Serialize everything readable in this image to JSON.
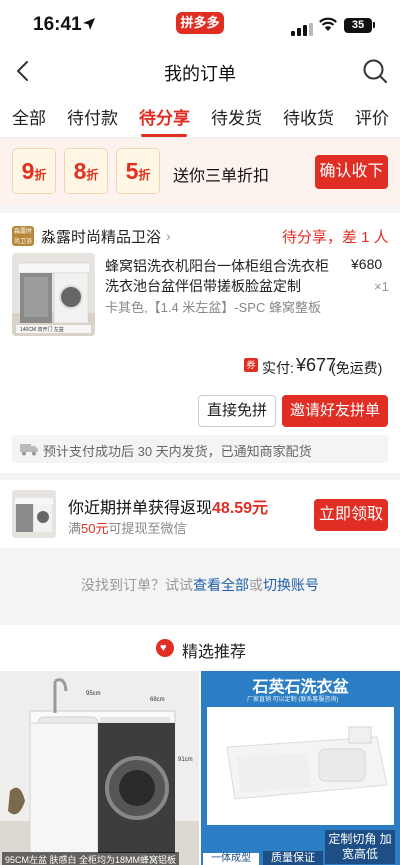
{
  "status_bar": {
    "time": "16:41",
    "app_badge": "拼多多",
    "battery": "35"
  },
  "nav": {
    "title": "我的订单"
  },
  "tabs": [
    {
      "label": "全部"
    },
    {
      "label": "待付款"
    },
    {
      "label": "待分享"
    },
    {
      "label": "待发货"
    },
    {
      "label": "待收货"
    },
    {
      "label": "评价"
    }
  ],
  "active_tab": "待分享",
  "coupons": {
    "items": [
      {
        "value": "9",
        "unit": "折"
      },
      {
        "value": "8",
        "unit": "折"
      },
      {
        "value": "5",
        "unit": "折"
      }
    ],
    "text": "送你三单折扣",
    "confirm_button": "确认收下"
  },
  "order": {
    "store_name": "淼露时尚精品卫浴",
    "store_logo_text": "淼露时尚卫浴",
    "status": "待分享，差 1 人",
    "product": {
      "title": "蜂窝铝洗衣机阳台一体柜组合洗衣柜洗衣池台盆伴侣带搓板脸盆定制",
      "price": "¥680",
      "quantity": "×1",
      "spec": "卡其色,【1.4 米左盆】-SPC 蜂窝整板",
      "image_caption": "140CM 双开门 左盆"
    },
    "paid_tag": "券",
    "paid_label": "实付:",
    "paid_amount": "¥677",
    "paid_note": "(免运费)",
    "button_direct": "直接免拼",
    "button_invite": "邀请好友拼单",
    "shipping_note": "预计支付成功后 30 天内发货，已通知商家配货"
  },
  "cashback": {
    "title_prefix": "你近期拼单获得返现",
    "amount": "48.59元",
    "sub_prefix": "满",
    "sub_amount": "50元",
    "sub_suffix": "可提现至微信",
    "button": "立即领取"
  },
  "not_found": {
    "prefix": "没找到订单？试试",
    "link_all": "查看全部",
    "or": "或",
    "link_switch": "切换账号"
  },
  "recommend": {
    "title": "精选推荐",
    "heart_glyph": "♥"
  },
  "reco_left": {
    "caption": "95CM左盆 肤感白    全柜均为18MM蜂窝铝板"
  },
  "reco_right": {
    "header": "石英石洗衣盆",
    "sub": "厂家直销  可以定制  (联系客服咨询)",
    "badge_custom": "定制切角 加宽高低",
    "badge_quality": "质量保证",
    "badge_body": "一体成型"
  },
  "colors": {
    "accent": "#e02e24",
    "link": "#1f5fa8"
  }
}
